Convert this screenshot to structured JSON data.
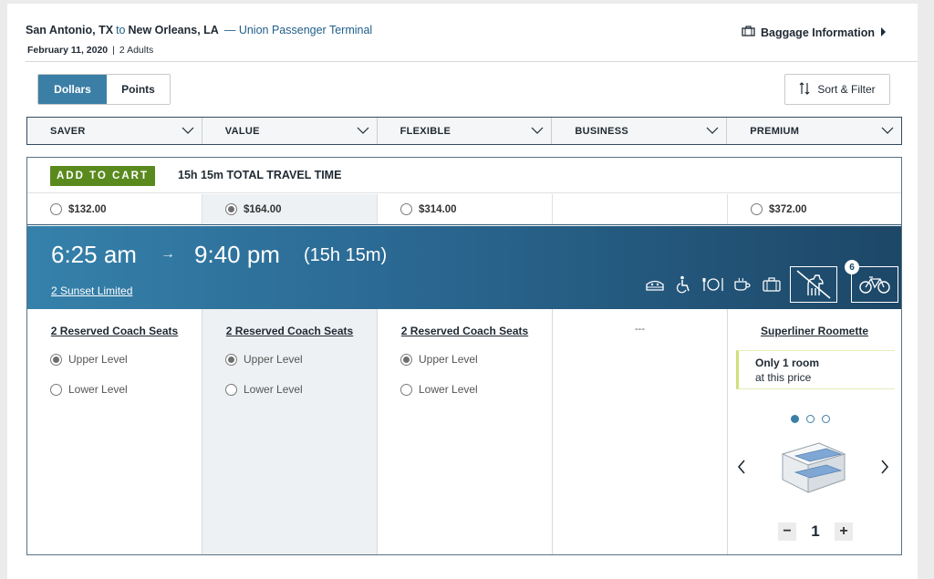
{
  "header": {
    "origin": "San Antonio, TX",
    "to_word": "to",
    "destination": "New Orleans, LA",
    "station": "— Union Passenger Terminal",
    "date": "February 11, 2020",
    "separator": "|",
    "passengers": "2 Adults",
    "baggage_label": "Baggage Information"
  },
  "currency_toggle": {
    "options": [
      "Dollars",
      "Points"
    ],
    "selected": "Dollars"
  },
  "sort_filter_label": "Sort & Filter",
  "fare_tabs": [
    "SAVER",
    "VALUE",
    "FLEXIBLE",
    "BUSINESS",
    "PREMIUM"
  ],
  "result": {
    "add_to_cart_label": "ADD TO CART",
    "total_travel_time": "15h 15m TOTAL TRAVEL TIME",
    "prices": [
      "$132.00",
      "$164.00",
      "$314.00",
      "",
      "$372.00"
    ],
    "selected_price_index": 1,
    "depart_time": "6:25 am",
    "arrow": "→",
    "arrive_time": "9:40 pm",
    "duration": "(15h 15m)",
    "train_name": "2 Sunset Limited",
    "amenity_icons": [
      "sleeper-icon",
      "wheelchair-icon",
      "dining-icon",
      "cafe-icon",
      "luggage-icon",
      "no-pets-icon",
      "bike-icon"
    ],
    "bike_count": "6",
    "seats": [
      {
        "title": "2 Reserved Coach Seats",
        "upper": "Upper Level",
        "lower": "Lower Level"
      },
      {
        "title": "2 Reserved Coach Seats",
        "upper": "Upper Level",
        "lower": "Lower Level"
      },
      {
        "title": "2 Reserved Coach Seats",
        "upper": "Upper Level",
        "lower": "Lower Level"
      }
    ],
    "business_placeholder": "---",
    "premium": {
      "title": "Superliner Roomette",
      "availability_bold": "Only 1 room",
      "availability_rest": "at this price",
      "carousel_dots": 3,
      "active_dot": 0,
      "quantity": "1",
      "minus": "−",
      "plus": "+"
    }
  },
  "colors": {
    "accent": "#3c7fa6",
    "add_to_cart": "#5a8a1e",
    "banner_start": "#3581ab",
    "banner_end": "#1d4767",
    "note_border": "#cfe07a"
  }
}
